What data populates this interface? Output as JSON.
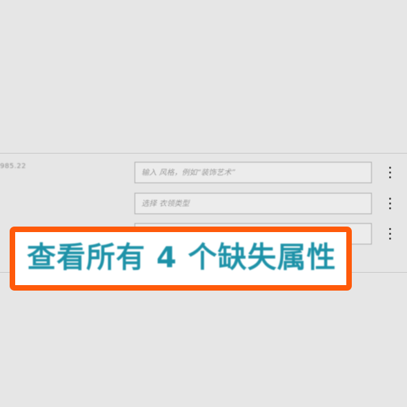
{
  "row": {
    "price": "985.22",
    "fields": [
      {
        "placeholder": "输入 风格，例如“装饰艺术”"
      },
      {
        "placeholder": "选择 衣领类型"
      },
      {
        "placeholder": ""
      }
    ]
  },
  "callout": {
    "label": "查看所有 4 个缺失属性",
    "accent_color": "#ff5a0a",
    "text_color": "#1e92a8"
  },
  "icons": {
    "row_menu": "more-vertical-icon"
  }
}
